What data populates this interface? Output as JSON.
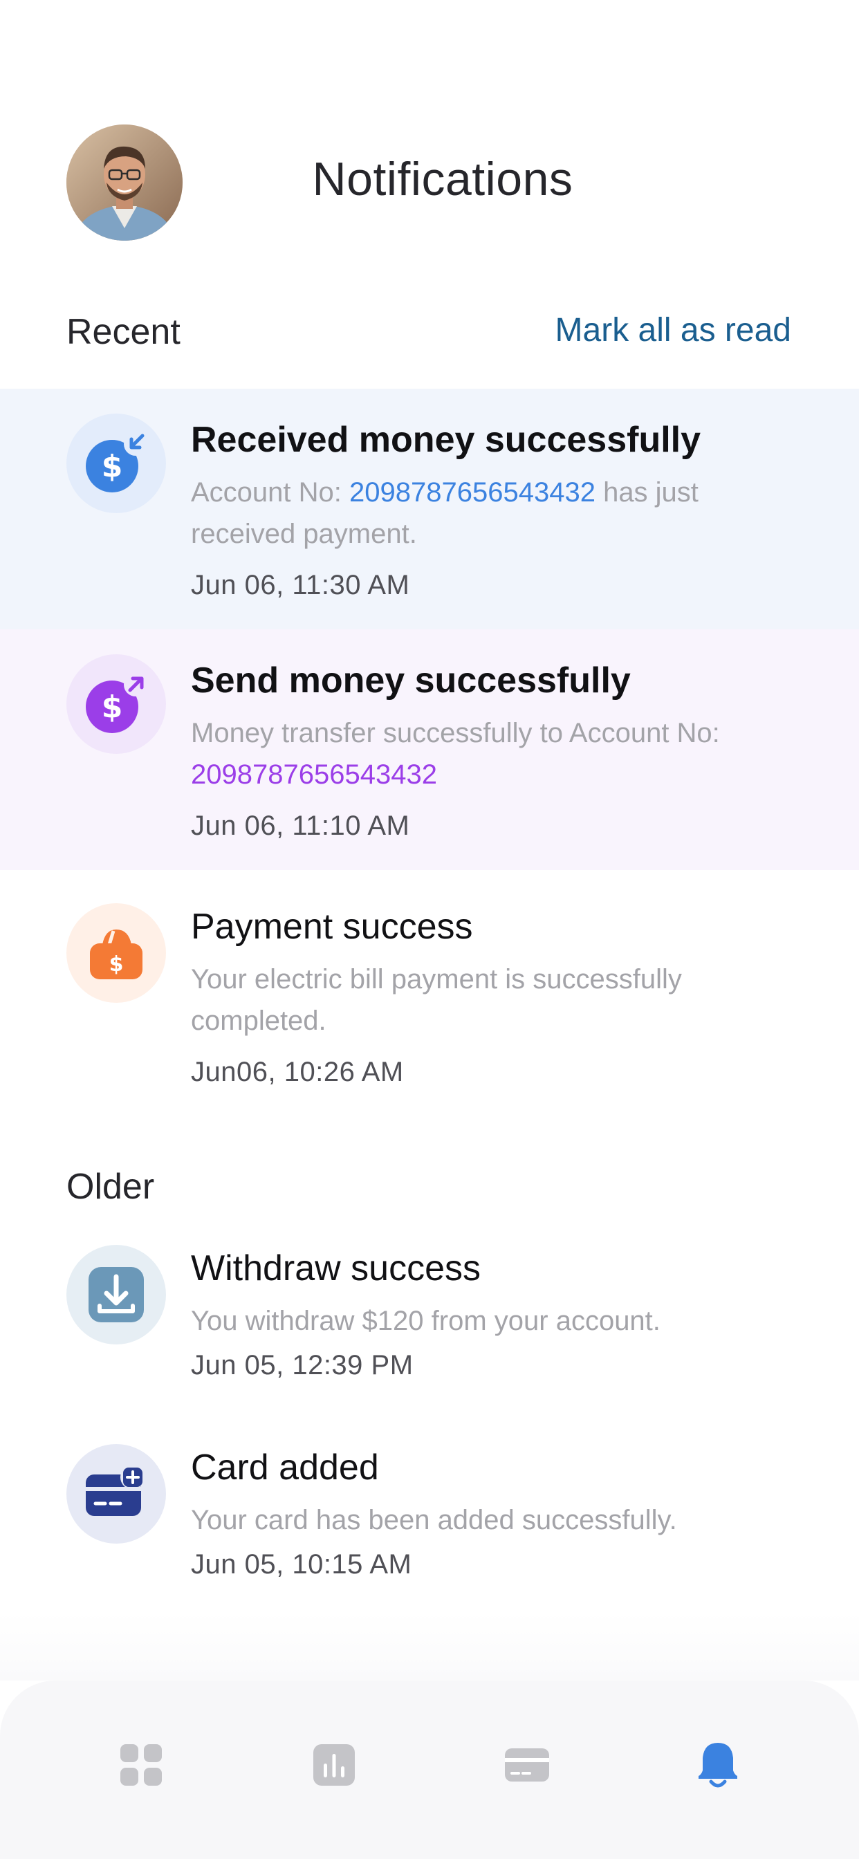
{
  "header": {
    "title": "Notifications",
    "avatar_alt": "profile photo"
  },
  "sections": {
    "recent_label": "Recent",
    "mark_all_label": "Mark all as read",
    "older_label": "Older"
  },
  "notifications": [
    {
      "title": "Received money successfully",
      "body_prefix": "Account No: ",
      "account": "2098787656543432",
      "body_suffix": " has just received payment.",
      "time": "Jun 06, 11:30 AM",
      "icon": "dollar-incoming-icon",
      "accent": "#3b82e0",
      "background": "#f1f5fc",
      "unread": true
    },
    {
      "title": "Send money successfully",
      "body_prefix": "Money transfer successfully to Account No: ",
      "account": "2098787656543432",
      "time": "Jun 06, 11:10 AM",
      "icon": "dollar-outgoing-icon",
      "accent": "#9b3ee8",
      "background": "#f9f4fd",
      "unread": true
    },
    {
      "title": "Payment success",
      "body": "Your electric bill payment is successfully completed.",
      "time": "Jun06, 10:26 AM",
      "icon": "wallet-dollar-icon",
      "accent": "#f47a35",
      "unread": false
    }
  ],
  "older": [
    {
      "title": "Withdraw success",
      "body": "You withdraw $120 from your account.",
      "time": "Jun 05, 12:39 PM",
      "icon": "withdraw-download-icon",
      "accent": "#6b98b8",
      "unread": false
    },
    {
      "title": "Card added",
      "body": "Your card has been added successfully.",
      "time": "Jun 05, 10:15 AM",
      "icon": "card-add-icon",
      "accent": "#2a3d8f",
      "unread": false
    }
  ],
  "tabbar": {
    "items": [
      {
        "name": "dashboard",
        "icon": "grid-icon",
        "active": false
      },
      {
        "name": "statistics",
        "icon": "bar-chart-icon",
        "active": false
      },
      {
        "name": "cards",
        "icon": "credit-card-icon",
        "active": false
      },
      {
        "name": "notifications",
        "icon": "bell-icon",
        "active": true
      }
    ],
    "active_color": "#3b82e0",
    "inactive_color": "#c4c4c8"
  }
}
